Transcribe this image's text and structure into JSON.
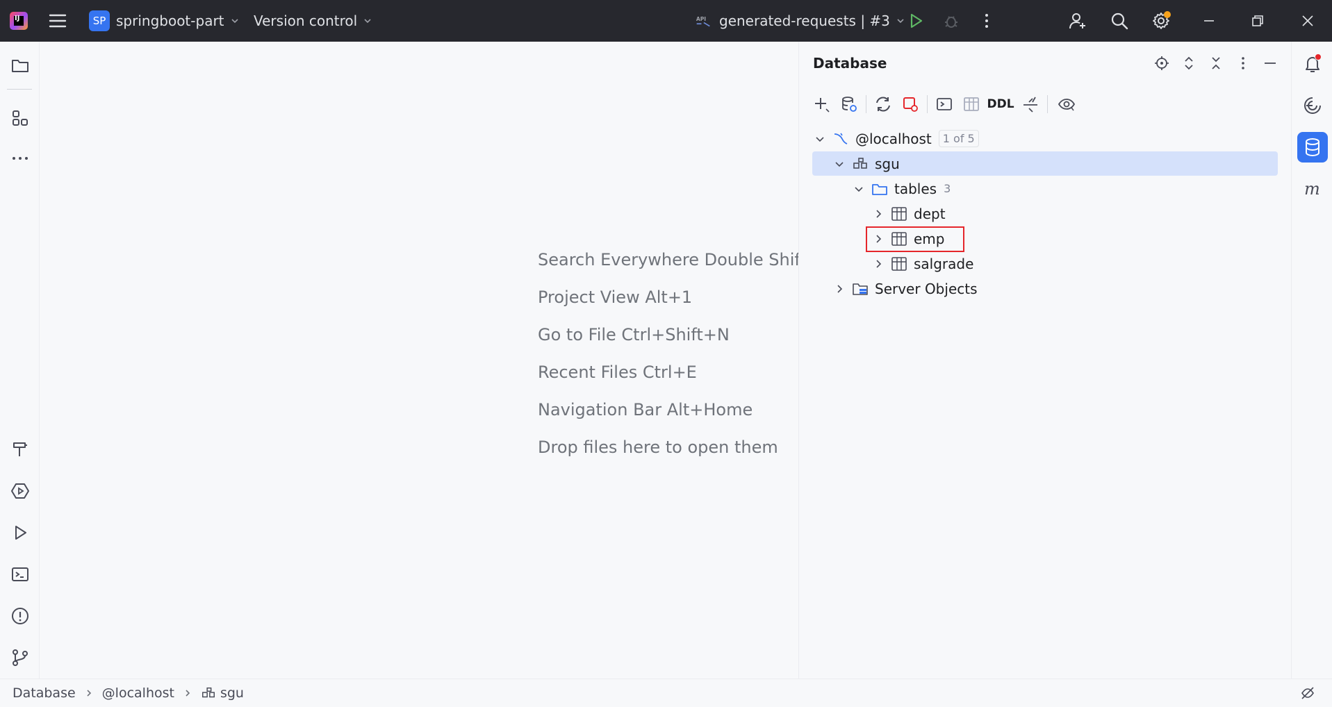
{
  "titlebar": {
    "app_icon": "intellij-idea-logo",
    "app_icon_text": "IJ",
    "menu_icon": "hamburger-icon",
    "project_badge": "SP",
    "project_name": "springboot-part",
    "vcs_label": "Version control",
    "run_config_icon": "api-icon",
    "run_config_label": "generated-requests | #3",
    "run_icon": "run-icon",
    "debug_icon": "debug-icon",
    "more_icon": "more-vertical-icon",
    "add_user_icon": "add-user-icon",
    "search_icon": "search-icon",
    "settings_icon": "gear-icon",
    "minimize_icon": "minimize-icon",
    "restore_icon": "restore-icon",
    "close_icon": "close-icon",
    "accent_color": "#3574f0",
    "run_color": "#5fb865"
  },
  "left_strip": {
    "top": [
      "folder-icon",
      "structure-icon",
      "more-horizontal-icon"
    ],
    "bottom": [
      "build-hammer-icon",
      "services-icon",
      "run-icon",
      "terminal-icon",
      "problems-icon",
      "git-branch-icon"
    ]
  },
  "editor": {
    "hints": [
      "Search Everywhere Double Shift",
      "Project View Alt+1",
      "Go to File Ctrl+Shift+N",
      "Recent Files Ctrl+E",
      "Navigation Bar Alt+Home",
      "Drop files here to open them"
    ]
  },
  "database": {
    "title": "Database",
    "header_icons": [
      "locate-icon",
      "expand-all-icon",
      "collapse-all-icon",
      "more-vertical-icon",
      "hide-icon"
    ],
    "toolbar": [
      "add-icon",
      "data-source-properties-icon",
      "refresh-icon",
      "disconnect-icon",
      "console-icon",
      "table-view-icon",
      "DDL",
      "jump-icon",
      "view-icon"
    ],
    "ddl_label": "DDL",
    "tree": {
      "host": {
        "label": "@localhost",
        "badge": "1 of 5"
      },
      "schema": {
        "label": "sgu"
      },
      "tables_folder": {
        "label": "tables",
        "count": "3"
      },
      "tables": [
        "dept",
        "emp",
        "salgrade"
      ],
      "server_objects": {
        "label": "Server Objects"
      }
    },
    "selected_color": "#d5e1fb",
    "highlight_color": "#e5262b"
  },
  "right_strip": [
    "notifications-icon",
    "ai-assistant-icon",
    "database-icon",
    "maven-icon"
  ],
  "right_strip_maven_text": "m",
  "statusbar": {
    "crumbs": [
      "Database",
      "@localhost",
      "sgu"
    ],
    "right_icon": "power-save-icon"
  }
}
